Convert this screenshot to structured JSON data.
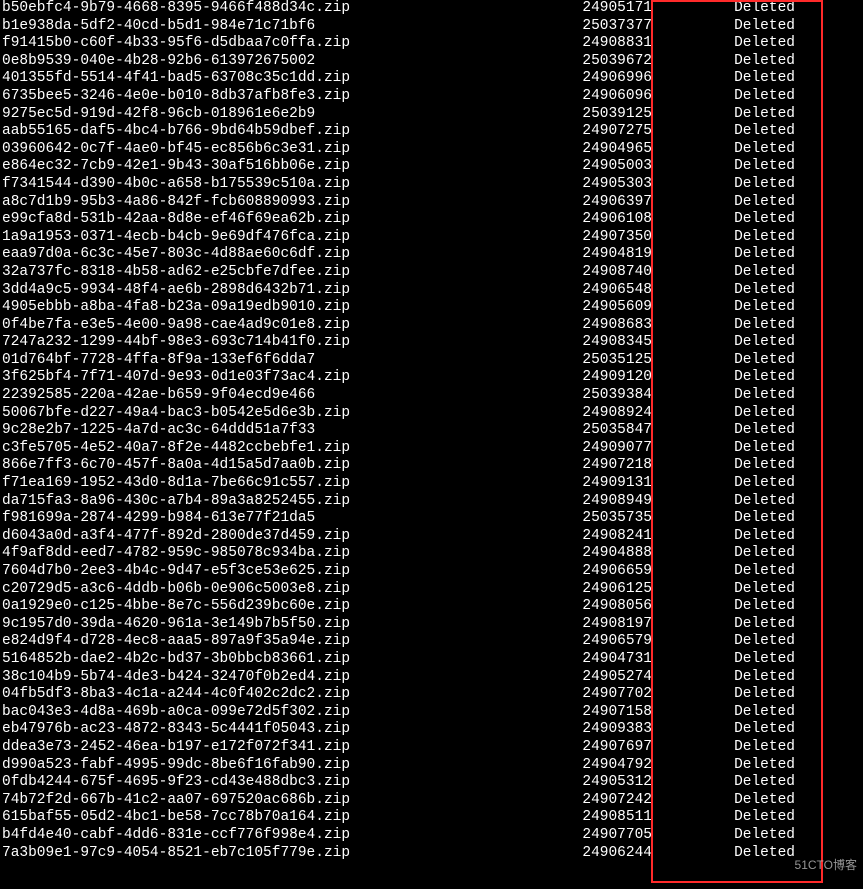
{
  "watermark": "51CTO博客",
  "rows": [
    {
      "name": "b50ebfc4-9b79-4668-8395-9466f488d34c.zip",
      "size": "24905171",
      "status": "Deleted"
    },
    {
      "name": "b1e938da-5df2-40cd-b5d1-984e71c71bf6",
      "size": "25037377",
      "status": "Deleted"
    },
    {
      "name": "f91415b0-c60f-4b33-95f6-d5dbaa7c0ffa.zip",
      "size": "24908831",
      "status": "Deleted"
    },
    {
      "name": "0e8b9539-040e-4b28-92b6-613972675002",
      "size": "25039672",
      "status": "Deleted"
    },
    {
      "name": "401355fd-5514-4f41-bad5-63708c35c1dd.zip",
      "size": "24906996",
      "status": "Deleted"
    },
    {
      "name": "6735bee5-3246-4e0e-b010-8db37afb8fe3.zip",
      "size": "24906096",
      "status": "Deleted"
    },
    {
      "name": "9275ec5d-919d-42f8-96cb-018961e6e2b9",
      "size": "25039125",
      "status": "Deleted"
    },
    {
      "name": "aab55165-daf5-4bc4-b766-9bd64b59dbef.zip",
      "size": "24907275",
      "status": "Deleted"
    },
    {
      "name": "03960642-0c7f-4ae0-bf45-ec856b6c3e31.zip",
      "size": "24904965",
      "status": "Deleted"
    },
    {
      "name": "e864ec32-7cb9-42e1-9b43-30af516bb06e.zip",
      "size": "24905003",
      "status": "Deleted"
    },
    {
      "name": "f7341544-d390-4b0c-a658-b175539c510a.zip",
      "size": "24905303",
      "status": "Deleted"
    },
    {
      "name": "a8c7d1b9-95b3-4a86-842f-fcb608890993.zip",
      "size": "24906397",
      "status": "Deleted"
    },
    {
      "name": "e99cfa8d-531b-42aa-8d8e-ef46f69ea62b.zip",
      "size": "24906108",
      "status": "Deleted"
    },
    {
      "name": "1a9a1953-0371-4ecb-b4cb-9e69df476fca.zip",
      "size": "24907350",
      "status": "Deleted"
    },
    {
      "name": "eaa97d0a-6c3c-45e7-803c-4d88ae60c6df.zip",
      "size": "24904819",
      "status": "Deleted"
    },
    {
      "name": "32a737fc-8318-4b58-ad62-e25cbfe7dfee.zip",
      "size": "24908740",
      "status": "Deleted"
    },
    {
      "name": "3dd4a9c5-9934-48f4-ae6b-2898d6432b71.zip",
      "size": "24906548",
      "status": "Deleted"
    },
    {
      "name": "4905ebbb-a8ba-4fa8-b23a-09a19edb9010.zip",
      "size": "24905609",
      "status": "Deleted"
    },
    {
      "name": "0f4be7fa-e3e5-4e00-9a98-cae4ad9c01e8.zip",
      "size": "24908683",
      "status": "Deleted"
    },
    {
      "name": "7247a232-1299-44bf-98e3-693c714b41f0.zip",
      "size": "24908345",
      "status": "Deleted"
    },
    {
      "name": "01d764bf-7728-4ffa-8f9a-133ef6f6dda7",
      "size": "25035125",
      "status": "Deleted"
    },
    {
      "name": "3f625bf4-7f71-407d-9e93-0d1e03f73ac4.zip",
      "size": "24909120",
      "status": "Deleted"
    },
    {
      "name": "22392585-220a-42ae-b659-9f04ecd9e466",
      "size": "25039384",
      "status": "Deleted"
    },
    {
      "name": "50067bfe-d227-49a4-bac3-b0542e5d6e3b.zip",
      "size": "24908924",
      "status": "Deleted"
    },
    {
      "name": "9c28e2b7-1225-4a7d-ac3c-64ddd51a7f33",
      "size": "25035847",
      "status": "Deleted"
    },
    {
      "name": "c3fe5705-4e52-40a7-8f2e-4482ccbebfe1.zip",
      "size": "24909077",
      "status": "Deleted"
    },
    {
      "name": "866e7ff3-6c70-457f-8a0a-4d15a5d7aa0b.zip",
      "size": "24907218",
      "status": "Deleted"
    },
    {
      "name": "f71ea169-1952-43d0-8d1a-7be66c91c557.zip",
      "size": "24909131",
      "status": "Deleted"
    },
    {
      "name": "da715fa3-8a96-430c-a7b4-89a3a8252455.zip",
      "size": "24908949",
      "status": "Deleted"
    },
    {
      "name": "f981699a-2874-4299-b984-613e77f21da5",
      "size": "25035735",
      "status": "Deleted"
    },
    {
      "name": "d6043a0d-a3f4-477f-892d-2800de37d459.zip",
      "size": "24908241",
      "status": "Deleted"
    },
    {
      "name": "4f9af8dd-eed7-4782-959c-985078c934ba.zip",
      "size": "24904888",
      "status": "Deleted"
    },
    {
      "name": "7604d7b0-2ee3-4b4c-9d47-e5f3ce53e625.zip",
      "size": "24906659",
      "status": "Deleted"
    },
    {
      "name": "c20729d5-a3c6-4ddb-b06b-0e906c5003e8.zip",
      "size": "24906125",
      "status": "Deleted"
    },
    {
      "name": "0a1929e0-c125-4bbe-8e7c-556d239bc60e.zip",
      "size": "24908056",
      "status": "Deleted"
    },
    {
      "name": "9c1957d0-39da-4620-961a-3e149b7b5f50.zip",
      "size": "24908197",
      "status": "Deleted"
    },
    {
      "name": "e824d9f4-d728-4ec8-aaa5-897a9f35a94e.zip",
      "size": "24906579",
      "status": "Deleted"
    },
    {
      "name": "5164852b-dae2-4b2c-bd37-3b0bbcb83661.zip",
      "size": "24904731",
      "status": "Deleted"
    },
    {
      "name": "38c104b9-5b74-4de3-b424-32470f0b2ed4.zip",
      "size": "24905274",
      "status": "Deleted"
    },
    {
      "name": "04fb5df3-8ba3-4c1a-a244-4c0f402c2dc2.zip",
      "size": "24907702",
      "status": "Deleted"
    },
    {
      "name": "bac043e3-4d8a-469b-a0ca-099e72d5f302.zip",
      "size": "24907158",
      "status": "Deleted"
    },
    {
      "name": "eb47976b-ac23-4872-8343-5c4441f05043.zip",
      "size": "24909383",
      "status": "Deleted"
    },
    {
      "name": "ddea3e73-2452-46ea-b197-e172f072f341.zip",
      "size": "24907697",
      "status": "Deleted"
    },
    {
      "name": "d990a523-fabf-4995-99dc-8be6f16fab90.zip",
      "size": "24904792",
      "status": "Deleted"
    },
    {
      "name": "0fdb4244-675f-4695-9f23-cd43e488dbc3.zip",
      "size": "24905312",
      "status": "Deleted"
    },
    {
      "name": "74b72f2d-667b-41c2-aa07-697520ac686b.zip",
      "size": "24907242",
      "status": "Deleted"
    },
    {
      "name": "615baf55-05d2-4bc1-be58-7cc78b70a164.zip",
      "size": "24908511",
      "status": "Deleted"
    },
    {
      "name": "b4fd4e40-cabf-4dd6-831e-ccf776f998e4.zip",
      "size": "24907705",
      "status": "Deleted"
    },
    {
      "name": "7a3b09e1-97c9-4054-8521-eb7c105f779e.zip",
      "size": "24906244",
      "status": "Deleted"
    }
  ]
}
